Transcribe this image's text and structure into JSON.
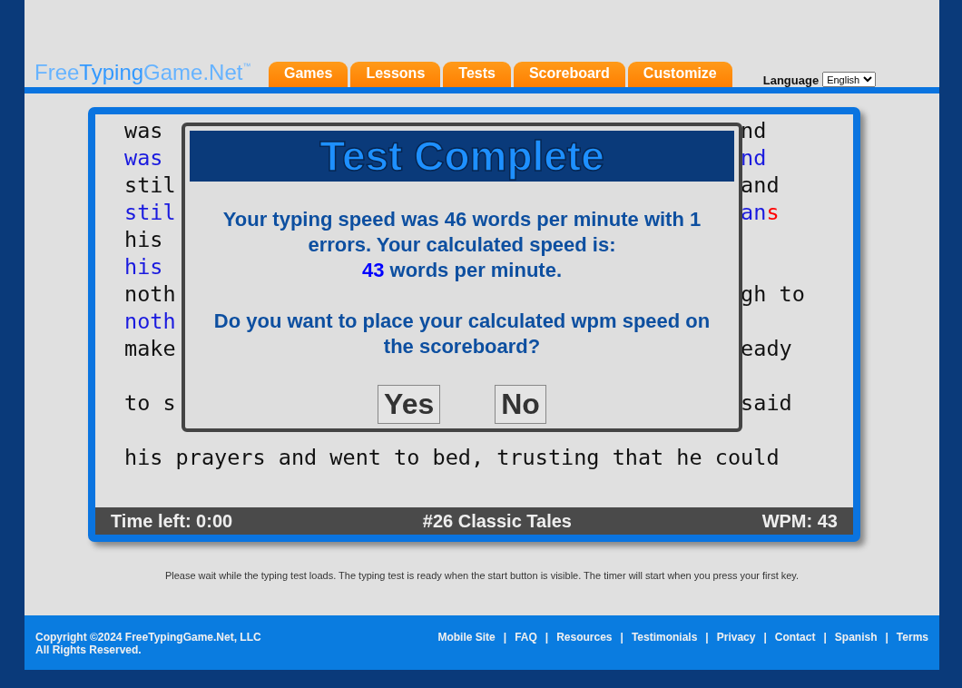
{
  "logo": {
    "parts": [
      {
        "text": "Free",
        "color": "#66b3ff"
      },
      {
        "text": "Typing",
        "color": "#3399ff"
      },
      {
        "text": "Game.Net",
        "color": "#66b3ff"
      }
    ],
    "mark": "™"
  },
  "tabs": [
    {
      "label": "Games"
    },
    {
      "label": "Lessons"
    },
    {
      "label": "Tests"
    },
    {
      "label": "Scoreboard"
    },
    {
      "label": "Customize"
    }
  ],
  "language": {
    "label": "Language",
    "value": "English"
  },
  "text_lines": [
    {
      "left": [
        {
          "text": "was",
          "typed": false,
          "error": false
        }
      ],
      "right": [
        {
          "text": "nd",
          "typed": false,
          "error": false
        }
      ]
    },
    {
      "left": [
        {
          "text": "was",
          "typed": true,
          "error": false
        }
      ],
      "right": [
        {
          "text": "nd",
          "typed": true,
          "error": false
        }
      ]
    },
    {
      "left": [
        {
          "text": "stil",
          "typed": false,
          "error": false
        }
      ],
      "right": [
        {
          "text": "and",
          "typed": false,
          "error": false
        }
      ]
    },
    {
      "left": [
        {
          "text": "stil",
          "typed": true,
          "error": false
        }
      ],
      "right": [
        {
          "text": "an",
          "typed": true,
          "error": false
        },
        {
          "text": "s",
          "typed": true,
          "error": true
        }
      ]
    },
    {
      "left": [
        {
          "text": "his",
          "typed": false,
          "error": false
        }
      ]
    },
    {
      "left": [
        {
          "text": "his",
          "typed": true,
          "error": false
        }
      ]
    },
    {
      "left": [
        {
          "text": "noth",
          "typed": false,
          "error": false
        }
      ],
      "right": [
        {
          "text": "gh to",
          "typed": false,
          "error": false
        }
      ]
    },
    {
      "left": [
        {
          "text": "noth",
          "typed": true,
          "error": false
        }
      ]
    },
    {
      "left": [
        {
          "text": "make",
          "typed": false,
          "error": false
        }
      ],
      "right": [
        {
          "text": "eady",
          "typed": false,
          "error": false
        }
      ],
      "gap_after": true
    },
    {
      "left": [
        {
          "text": "to s",
          "typed": false,
          "error": false
        }
      ],
      "right": [
        {
          "text": "said",
          "typed": false,
          "error": false
        }
      ],
      "gap_after": true
    },
    {
      "left": [
        {
          "text": "his prayers and went to bed, trusting that he could",
          "typed": false,
          "error": false
        }
      ]
    }
  ],
  "status_bar": {
    "time_left": "Time left: 0:00",
    "title": "#26 Classic Tales",
    "wpm": "WPM: 43"
  },
  "dialog": {
    "title": "Test Complete",
    "message": "Your typing speed was 46 words per minute with 1 errors. Your calculated speed is:",
    "speed": "43",
    "speed_suffix": "words per minute.",
    "question": "Do you want to place your calculated wpm speed on the scoreboard?",
    "buttons": [
      "Yes",
      "No"
    ]
  },
  "note": "Please wait while the typing test loads. The typing test is ready when the start button is visible. The timer will start when you press your first key.",
  "footer": {
    "copyright": "Copyright ©2024 FreeTypingGame.Net, LLC",
    "rights": "All Rights Reserved.",
    "links": [
      "Mobile Site",
      "FAQ",
      "Resources",
      "Testimonials",
      "Privacy",
      "Contact",
      "Spanish",
      "Terms"
    ],
    "separator": "|"
  }
}
